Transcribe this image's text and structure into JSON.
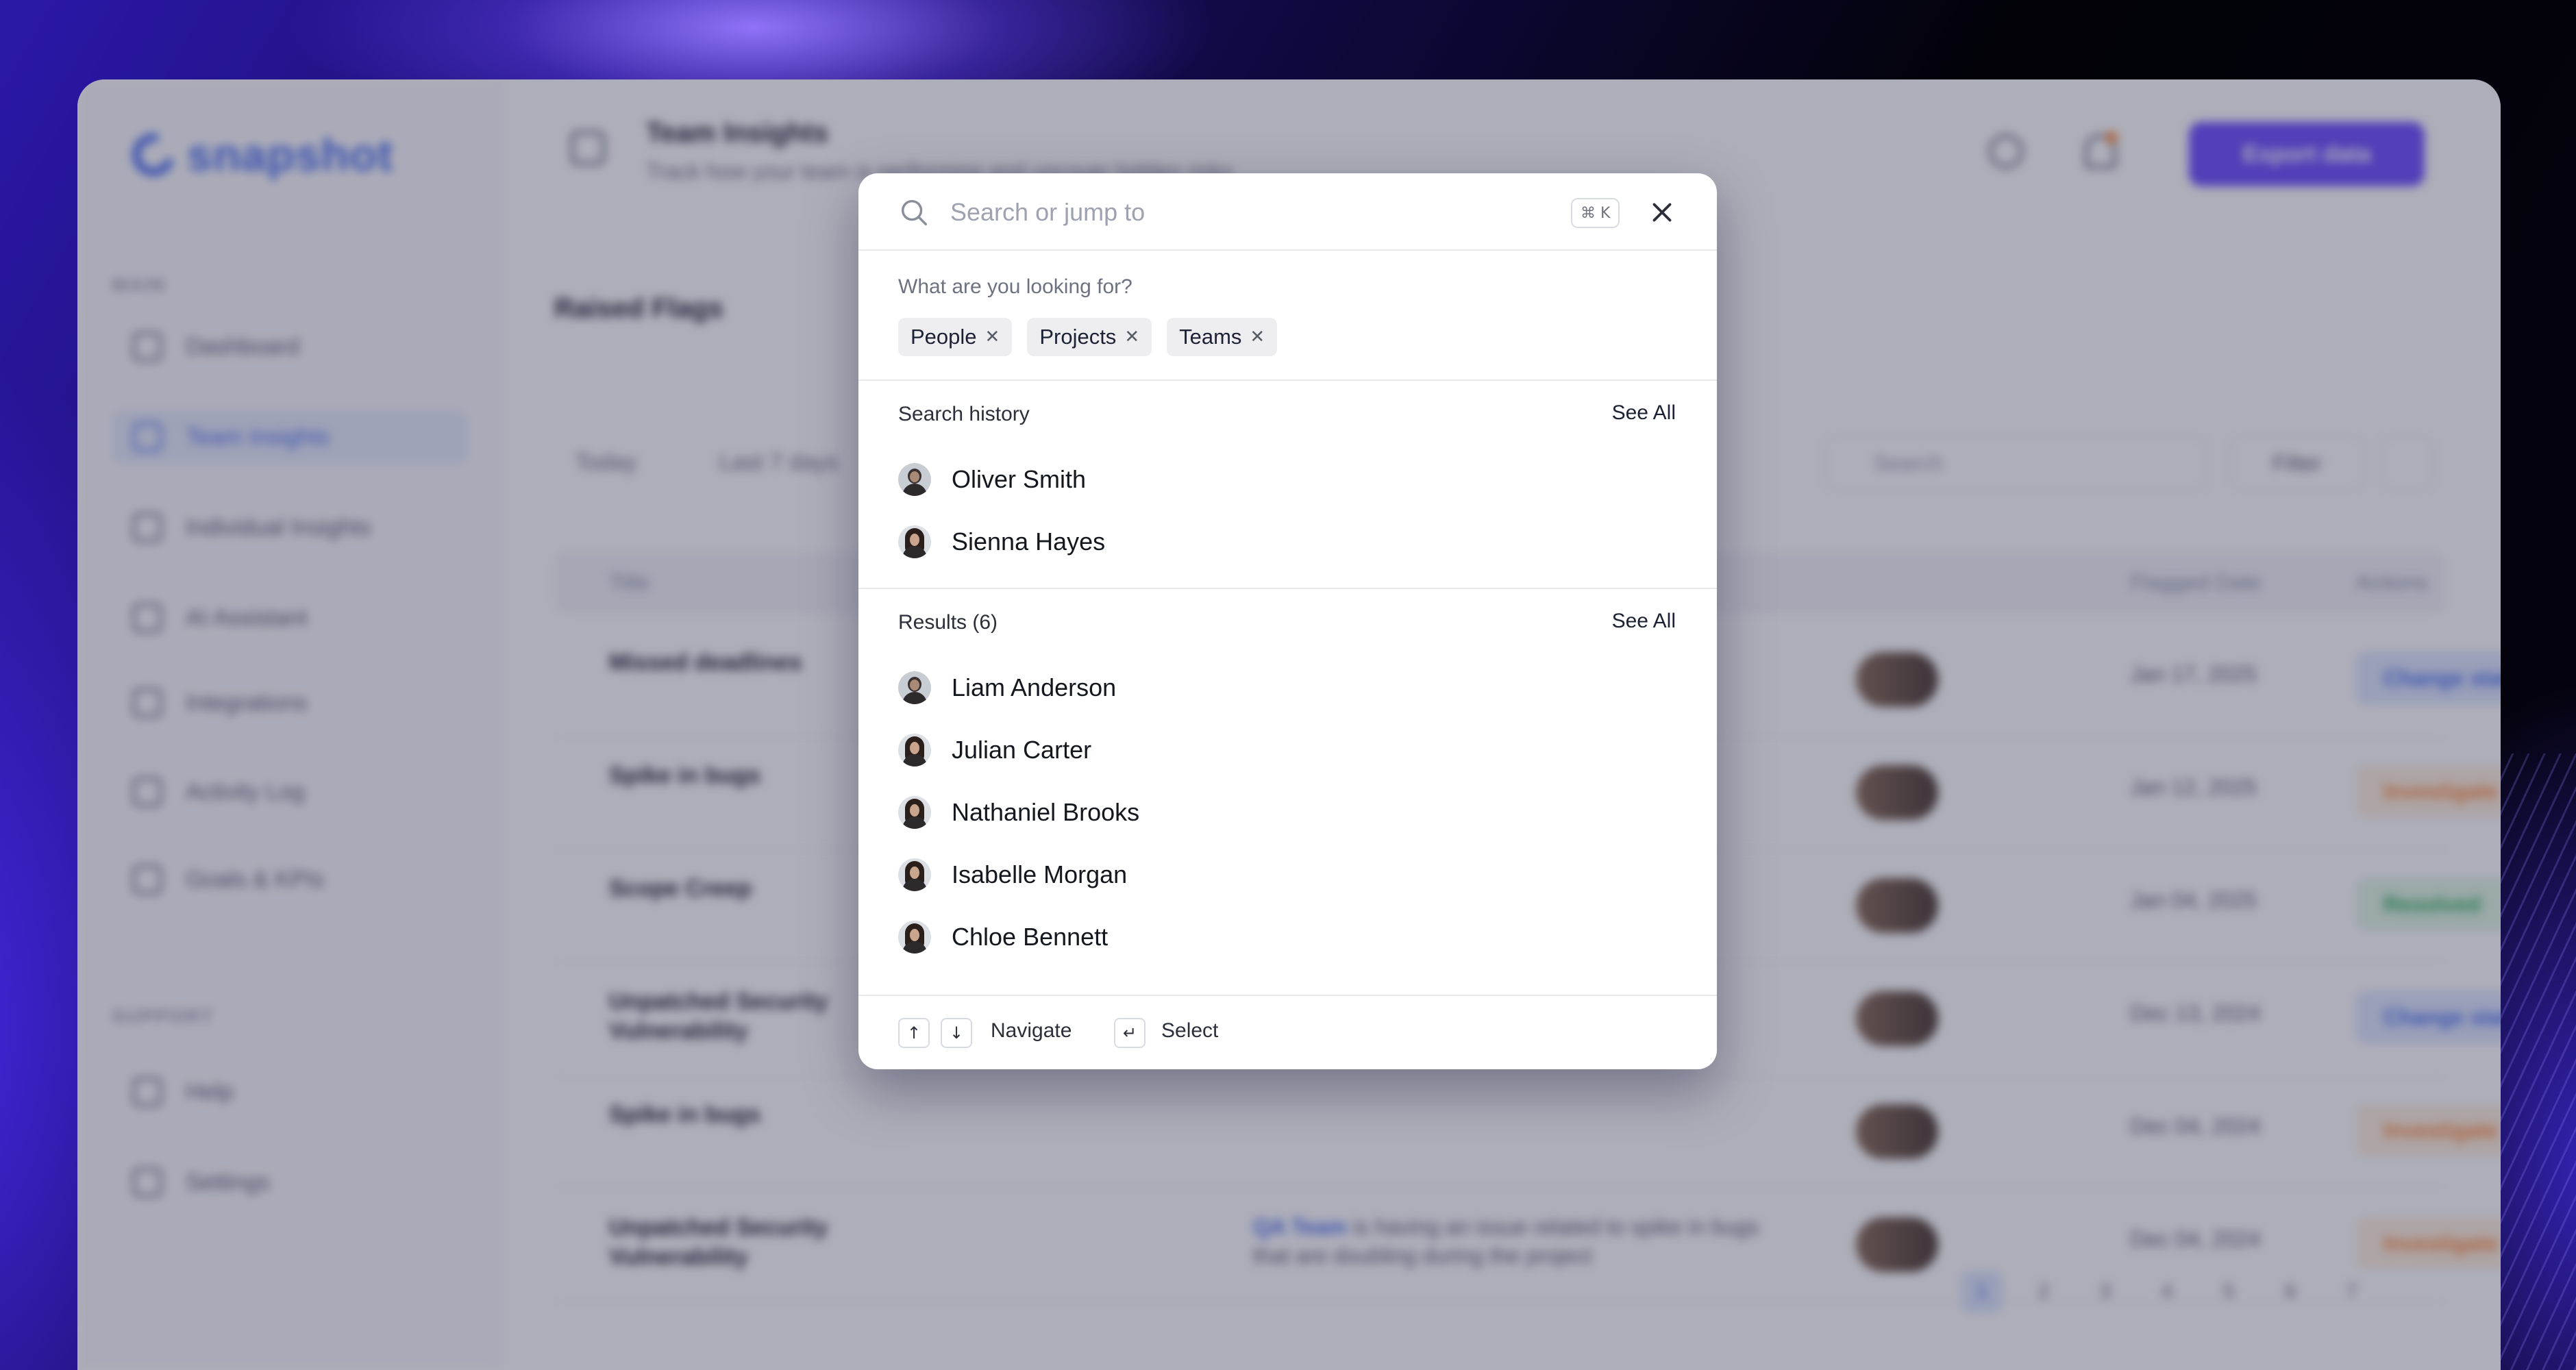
{
  "background_app": {
    "logo": "snapshot",
    "sidebar": {
      "main_section": "MAIN",
      "items": [
        {
          "label": "Dashboard",
          "icon": "grid-icon"
        },
        {
          "label": "Team Insights",
          "icon": "team-icon",
          "active": true
        },
        {
          "label": "Individual Insights",
          "icon": "user-icon"
        },
        {
          "label": "AI Assistant",
          "icon": "sparkle-icon"
        },
        {
          "label": "Integrations",
          "icon": "plug-icon"
        },
        {
          "label": "Activity Log",
          "icon": "log-icon"
        },
        {
          "label": "Goals & KPIs",
          "icon": "target-icon"
        }
      ],
      "support_section": "SUPPORT",
      "support_items": [
        {
          "label": "Help",
          "icon": "help-icon"
        },
        {
          "label": "Settings",
          "icon": "settings-icon"
        }
      ]
    },
    "header": {
      "title": "Team Insights",
      "subtitle": "Track how your team is performing and uncover hidden risks",
      "export_label": "Export data"
    },
    "section_title": "Raised Flags",
    "tabs": [
      "Today",
      "Last 7 days"
    ],
    "search_placeholder": "Search",
    "filter_label": "Filter",
    "table_headers": [
      "Title",
      "Flagged Date",
      "Actions"
    ],
    "rows": [
      {
        "title": "Missed deadlines",
        "date": "Jan 17, 2025",
        "status": "Change status",
        "status_kind": "blue"
      },
      {
        "title": "Spike in bugs",
        "date": "Jan 12, 2025",
        "status": "Investigate",
        "status_kind": "orange"
      },
      {
        "title": "Scope Creep",
        "date": "Jan 04, 2025",
        "status": "Resolved",
        "status_kind": "green"
      },
      {
        "title": "Unpatched Security Vulnerability",
        "date": "Dec 13, 2024",
        "status": "Change status",
        "status_kind": "blue"
      },
      {
        "title": "Spike in bugs",
        "date": "Dec 04, 2024",
        "status": "Investigate",
        "status_kind": "orange"
      },
      {
        "title": "Unpatched Security Vulnerability",
        "desc_mention": "QA Team",
        "desc": "is having an issue related to spike in bugs that are doubling during the project",
        "date": "Dec 04, 2024",
        "status": "Investigate",
        "status_kind": "orange"
      }
    ],
    "pagination": [
      "1",
      "2",
      "3",
      "4",
      "5",
      "6",
      "7"
    ],
    "colors": {
      "accent": "#6d4cff",
      "link": "#4b6cf0"
    }
  },
  "palette": {
    "search": {
      "placeholder": "Search or jump to",
      "value": ""
    },
    "shortcut_hint": "⌘ K",
    "close_icon": "close-icon",
    "filter_prompt": "What are you looking for?",
    "chips": [
      {
        "label": "People"
      },
      {
        "label": "Projects"
      },
      {
        "label": "Teams"
      }
    ],
    "chip_remove_glyph": "✕",
    "history": {
      "title": "Search history",
      "see_all": "See All",
      "people": [
        {
          "name": "Oliver Smith",
          "avatar": "male"
        },
        {
          "name": "Sienna Hayes",
          "avatar": "female"
        }
      ]
    },
    "results": {
      "title": "Results (6)",
      "see_all": "See All",
      "people": [
        {
          "name": "Liam Anderson",
          "avatar": "male"
        },
        {
          "name": "Julian Carter",
          "avatar": "female"
        },
        {
          "name": "Nathaniel Brooks",
          "avatar": "female"
        },
        {
          "name": "Isabelle Morgan",
          "avatar": "female"
        },
        {
          "name": "Chloe Bennett",
          "avatar": "female"
        }
      ]
    },
    "footer": {
      "up_key": "↑",
      "down_key": "↓",
      "navigate_label": "Navigate",
      "enter_key": "↵",
      "select_label": "Select"
    }
  }
}
